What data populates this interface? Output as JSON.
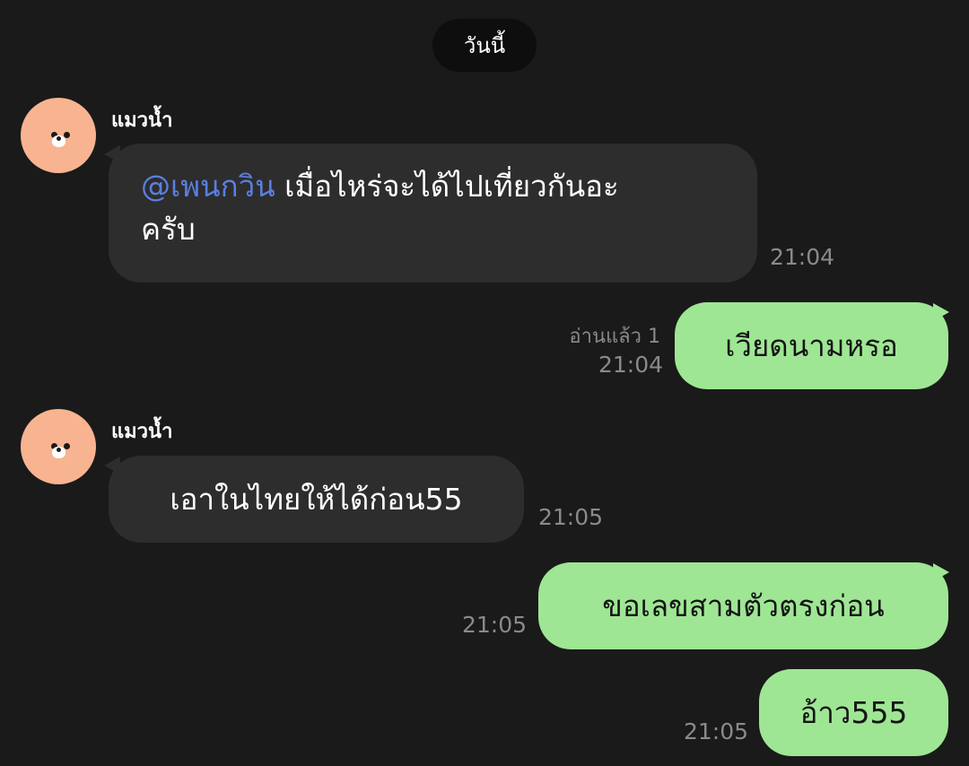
{
  "date_separator": "วันนี้",
  "messages": [
    {
      "sender": "แมวน้ำ",
      "mention": "@เพนกวิน",
      "text": "เมื่อไหร่จะได้ไปเที่ยวกันอะ",
      "text_line2": "ครับ",
      "time": "21:04"
    },
    {
      "text": "เวียดนามหรอ",
      "read": "อ่านแล้ว 1",
      "time": "21:04"
    },
    {
      "sender": "แมวน้ำ",
      "text": "เอาในไทยให้ได้ก่อน55",
      "time": "21:05"
    },
    {
      "text": "ขอเลขสามตัวตรงก่อน",
      "time": "21:05"
    },
    {
      "text": "อ้าว555",
      "time": "21:05"
    }
  ]
}
